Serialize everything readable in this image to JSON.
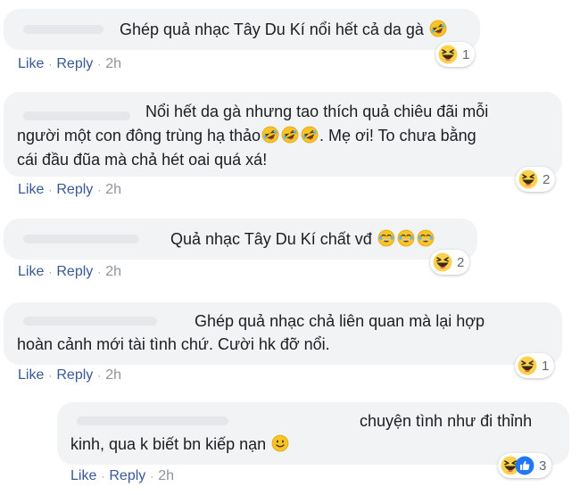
{
  "actions": {
    "like": "Like",
    "reply": "Reply",
    "separator": "·"
  },
  "comments": [
    {
      "text": "Ghép quả nhạc Tây Du Kí nổi hết cả da gà",
      "emojis": [
        "rofl"
      ],
      "time": "2h",
      "reactions": [
        "haha"
      ],
      "reaction_count": "1"
    },
    {
      "lines": [
        "Nổi hết da gà nhưng tao thích quả chiêu đãi mỗi",
        "người một con đông trùng hạ thảo",
        ". Mẹ ơi! To chưa bằng",
        "cái đầu đũa mà chả hét oai quá xá!"
      ],
      "emojis": [
        "rofl",
        "rofl",
        "rofl"
      ],
      "time": "2h",
      "reactions": [
        "haha"
      ],
      "reaction_count": "2"
    },
    {
      "text": "Quả nhạc Tây Du Kí chất vđ",
      "emojis": [
        "joy",
        "joy",
        "joy"
      ],
      "time": "2h",
      "reactions": [
        "haha"
      ],
      "reaction_count": "2"
    },
    {
      "lines": [
        "Ghép quả nhạc chả liên quan mà lại hợp",
        "hoàn cảnh mới tài tình chứ. Cười hk đỡ nổi."
      ],
      "time": "2h",
      "reactions": [
        "haha"
      ],
      "reaction_count": "1"
    },
    {
      "lines": [
        "chuyện tình như đi thỉnh",
        "kinh, qua k biết bn kiếp nạn"
      ],
      "emojis": [
        "smile"
      ],
      "time": "2h",
      "reactions": [
        "haha",
        "like"
      ],
      "reaction_count": "3"
    }
  ],
  "colors": {
    "bubble": "#f2f3f5",
    "link": "#385898",
    "muted": "#90949c",
    "emoji_yellow": "#f7b125",
    "like_blue": "#2078f4"
  }
}
